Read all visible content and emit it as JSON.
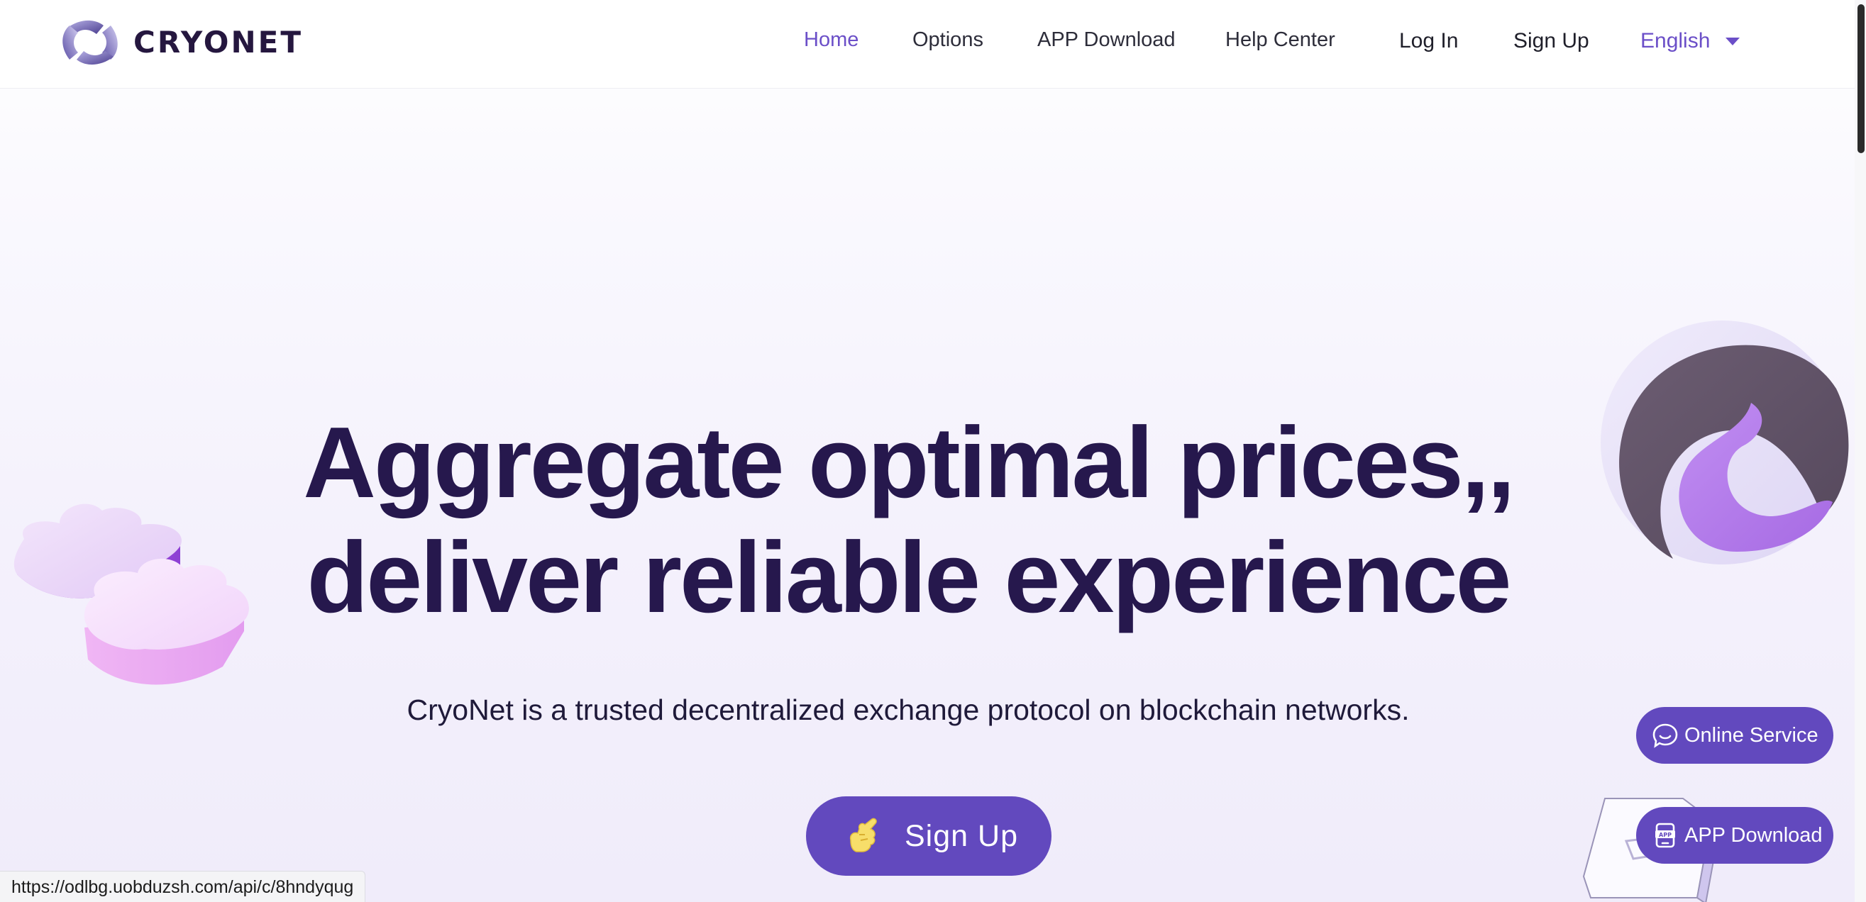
{
  "brand": {
    "name": "CRYONET"
  },
  "nav": {
    "home": "Home",
    "options": "Options",
    "app_download": "APP Download",
    "help_center": "Help Center",
    "login": "Log In",
    "signup": "Sign Up",
    "language": "English"
  },
  "hero": {
    "headline_line1": "Aggregate optimal prices,,",
    "headline_line2": "deliver reliable experience",
    "subtitle": "CryoNet is a trusted decentralized exchange protocol on blockchain networks.",
    "cta_label": "Sign Up"
  },
  "floating": {
    "online_service": "Online Service",
    "app_download": "APP Download"
  },
  "status_bar": {
    "url": "https://odlbg.uobduzsh.com/api/c/8hndyqug"
  },
  "colors": {
    "accent": "#6249be",
    "active_nav": "#6b4fc8",
    "headline": "#26184d"
  },
  "icons": {
    "logo": "cryonet-logo-icon",
    "caret": "caret-down-icon",
    "cta": "pointing-hand-icon",
    "online_service": "chat-bubble-icon",
    "app_download": "phone-app-icon"
  }
}
